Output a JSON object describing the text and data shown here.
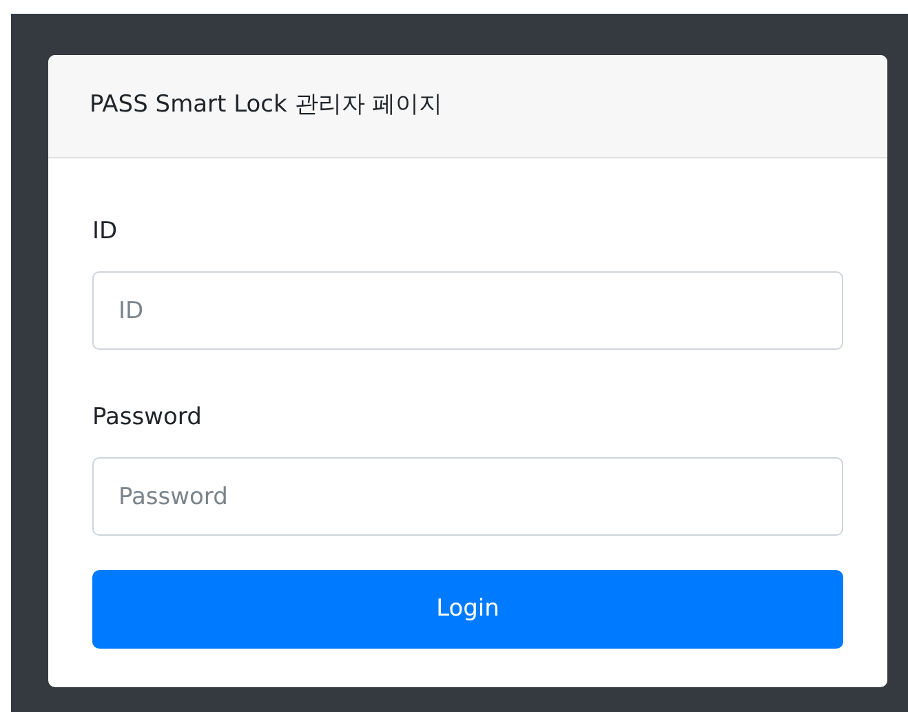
{
  "card": {
    "title": "PASS Smart Lock 관리자 페이지"
  },
  "fields": [
    {
      "label": "ID",
      "placeholder": "ID"
    },
    {
      "label": "Password",
      "placeholder": "Password"
    }
  ],
  "button": {
    "label": "Login"
  }
}
